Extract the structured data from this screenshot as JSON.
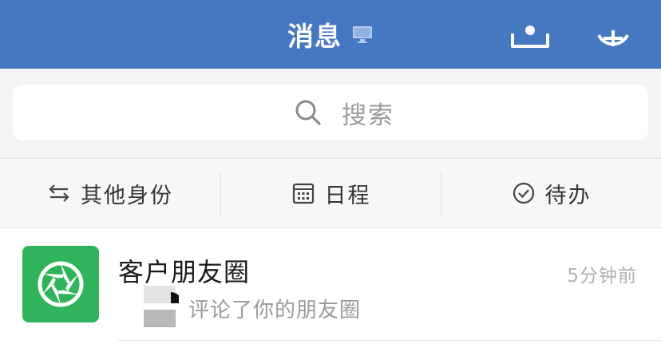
{
  "header": {
    "title": "消息",
    "pc_icon": "desktop-icon",
    "left_button_icon": "contacts-icon",
    "right_button_icon": "add-icon",
    "bg_color": "#4677c1"
  },
  "search": {
    "placeholder": "搜索",
    "icon": "search-icon"
  },
  "quick_actions": [
    {
      "label": "其他身份",
      "icon": "switch-arrows-icon"
    },
    {
      "label": "日程",
      "icon": "calendar-icon"
    },
    {
      "label": "待办",
      "icon": "check-circle-icon"
    }
  ],
  "messages": [
    {
      "title": "客户朋友圈",
      "time": "5分钟前",
      "preview": "评论了你的朋友圈",
      "avatar_icon": "aperture-icon",
      "avatar_color": "#2fb35b"
    }
  ]
}
